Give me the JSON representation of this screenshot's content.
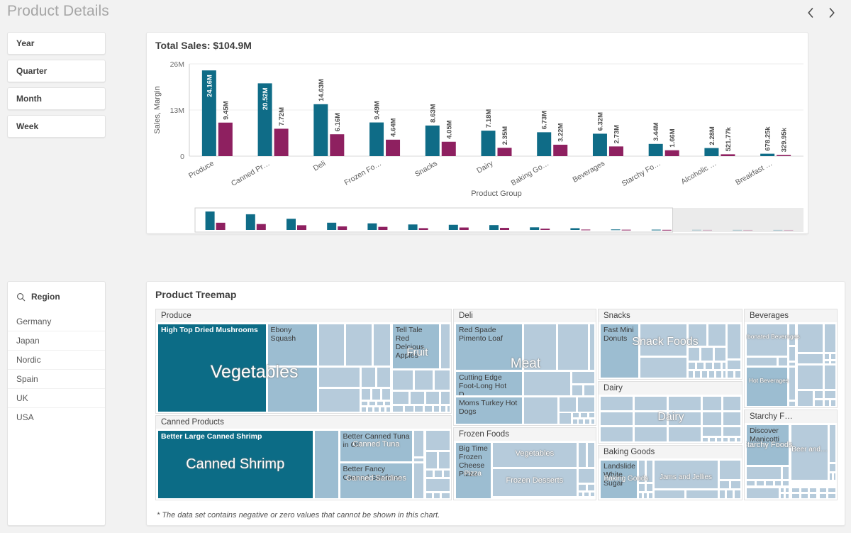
{
  "header": {
    "title": "Product Details",
    "nav_prev": "‹",
    "nav_next": "›"
  },
  "filters": [
    {
      "label": "Year"
    },
    {
      "label": "Quarter"
    },
    {
      "label": "Month"
    },
    {
      "label": "Week"
    }
  ],
  "region_listbox": {
    "title": "Region",
    "search_icon": "search-icon",
    "items": [
      "Germany",
      "Japan",
      "Nordic",
      "Spain",
      "UK",
      "USA"
    ]
  },
  "bar_card": {
    "title": "Total Sales: $104.9M"
  },
  "treemap_card": {
    "title": "Product Treemap",
    "footnote": "* The data set contains negative or zero values that cannot be shown in this chart."
  },
  "colors": {
    "sales_teal": "#0f6c87",
    "margin_magenta": "#8e2060",
    "treemap_dark": "#0c6c86",
    "treemap_mid": "#9cbdd1",
    "treemap_light": "#b6cbdb",
    "treemap_pale": "#c3d4e0",
    "page_bg": "#f2f2f2",
    "card_bg": "#ffffff"
  },
  "chart_data": {
    "type": "bar",
    "title": "Total Sales: $104.9M",
    "xlabel": "Product Group",
    "ylabel": "Sales, Margin",
    "ylim": [
      0,
      26000000
    ],
    "yticks": [
      0,
      13000000,
      26000000
    ],
    "ytick_labels": [
      "0",
      "13M",
      "26M"
    ],
    "grid": true,
    "legend": "none",
    "categories": [
      "Produce",
      "Canned Pr…",
      "Deli",
      "Frozen Fo…",
      "Snacks",
      "Dairy",
      "Baking Go…",
      "Beverages",
      "Starchy Fo…",
      "Alcoholic …",
      "Breakfast …"
    ],
    "series": [
      {
        "name": "Sales",
        "color": "#0f6c87",
        "values": [
          24160000,
          20520000,
          14630000,
          9490000,
          8630000,
          7180000,
          6730000,
          6320000,
          3440000,
          2280000,
          678250
        ],
        "labels": [
          "24.16M",
          "20.52M",
          "14.63M",
          "9.49M",
          "8.63M",
          "7.18M",
          "6.73M",
          "6.32M",
          "3.44M",
          "2.28M",
          "678.25k"
        ]
      },
      {
        "name": "Margin",
        "color": "#8e2060",
        "values": [
          9450000,
          7720000,
          6160000,
          4640000,
          4050000,
          2350000,
          3220000,
          2730000,
          1660000,
          521770,
          329950
        ],
        "labels": [
          "9.45M",
          "7.72M",
          "6.16M",
          "4.64M",
          "4.05M",
          "2.35M",
          "3.22M",
          "2.73M",
          "1.66M",
          "521.77k",
          "329.95k"
        ]
      }
    ],
    "scrollbar": {
      "visible_fraction": 0.785,
      "offset_fraction": 0.0
    }
  },
  "treemap_data": {
    "type": "treemap",
    "groups": [
      {
        "name": "Produce",
        "category_labels": [
          {
            "text": "Vegetables",
            "size": 26
          },
          {
            "text": "Fruit",
            "size": 15
          }
        ],
        "leaf_labels": [
          "High Top Dried Mushrooms",
          "Ebony Squash",
          "Tell Tale Red Delcious Apples"
        ]
      },
      {
        "name": "Canned Products",
        "category_labels": [
          {
            "text": "Canned Shrimp",
            "size": 20
          },
          {
            "text": "Canned Tuna",
            "size": 12
          },
          {
            "text": "Canned Sardines",
            "size": 11
          }
        ],
        "leaf_labels": [
          "Better Large Canned Shrimp",
          "Better Canned Tuna in Oil",
          "Better Fancy Canned Sardines"
        ]
      },
      {
        "name": "Deli",
        "category_labels": [
          {
            "text": "Meat",
            "size": 19
          }
        ],
        "leaf_labels": [
          "Red Spade Pimento Loaf",
          "Cutting Edge Foot-Long Hot D…",
          "Moms Turkey Hot Dogs"
        ]
      },
      {
        "name": "Frozen Foods",
        "category_labels": [
          {
            "text": "Vegetables",
            "size": 11
          },
          {
            "text": "Frozen Desserts",
            "size": 11
          },
          {
            "text": "Pizza",
            "size": 10
          }
        ],
        "leaf_labels": [
          "Big Time Frozen Cheese Pizza"
        ]
      },
      {
        "name": "Snacks",
        "category_labels": [
          {
            "text": "Snack Foods",
            "size": 16
          }
        ],
        "leaf_labels": [
          "Fast Mini Donuts"
        ]
      },
      {
        "name": "Dairy",
        "category_labels": [
          {
            "text": "Dairy",
            "size": 16
          }
        ],
        "leaf_labels": []
      },
      {
        "name": "Baking Goods",
        "category_labels": [
          {
            "text": "Baking Goods",
            "size": 11
          },
          {
            "text": "Jams and Jellies",
            "size": 11
          }
        ],
        "leaf_labels": [
          "Landslide White Sugar"
        ]
      },
      {
        "name": "Beverages",
        "category_labels": [
          {
            "text": "Carbonated Beverages",
            "size": 9
          },
          {
            "text": "Hot Beverages",
            "size": 9
          }
        ],
        "leaf_labels": []
      },
      {
        "name": "Starchy F…",
        "category_labels": [
          {
            "text": "Starchy Foods",
            "size": 11
          },
          {
            "text": "Beer and…",
            "size": 10
          }
        ],
        "leaf_labels": [
          "Discover Manicotti"
        ]
      }
    ]
  }
}
